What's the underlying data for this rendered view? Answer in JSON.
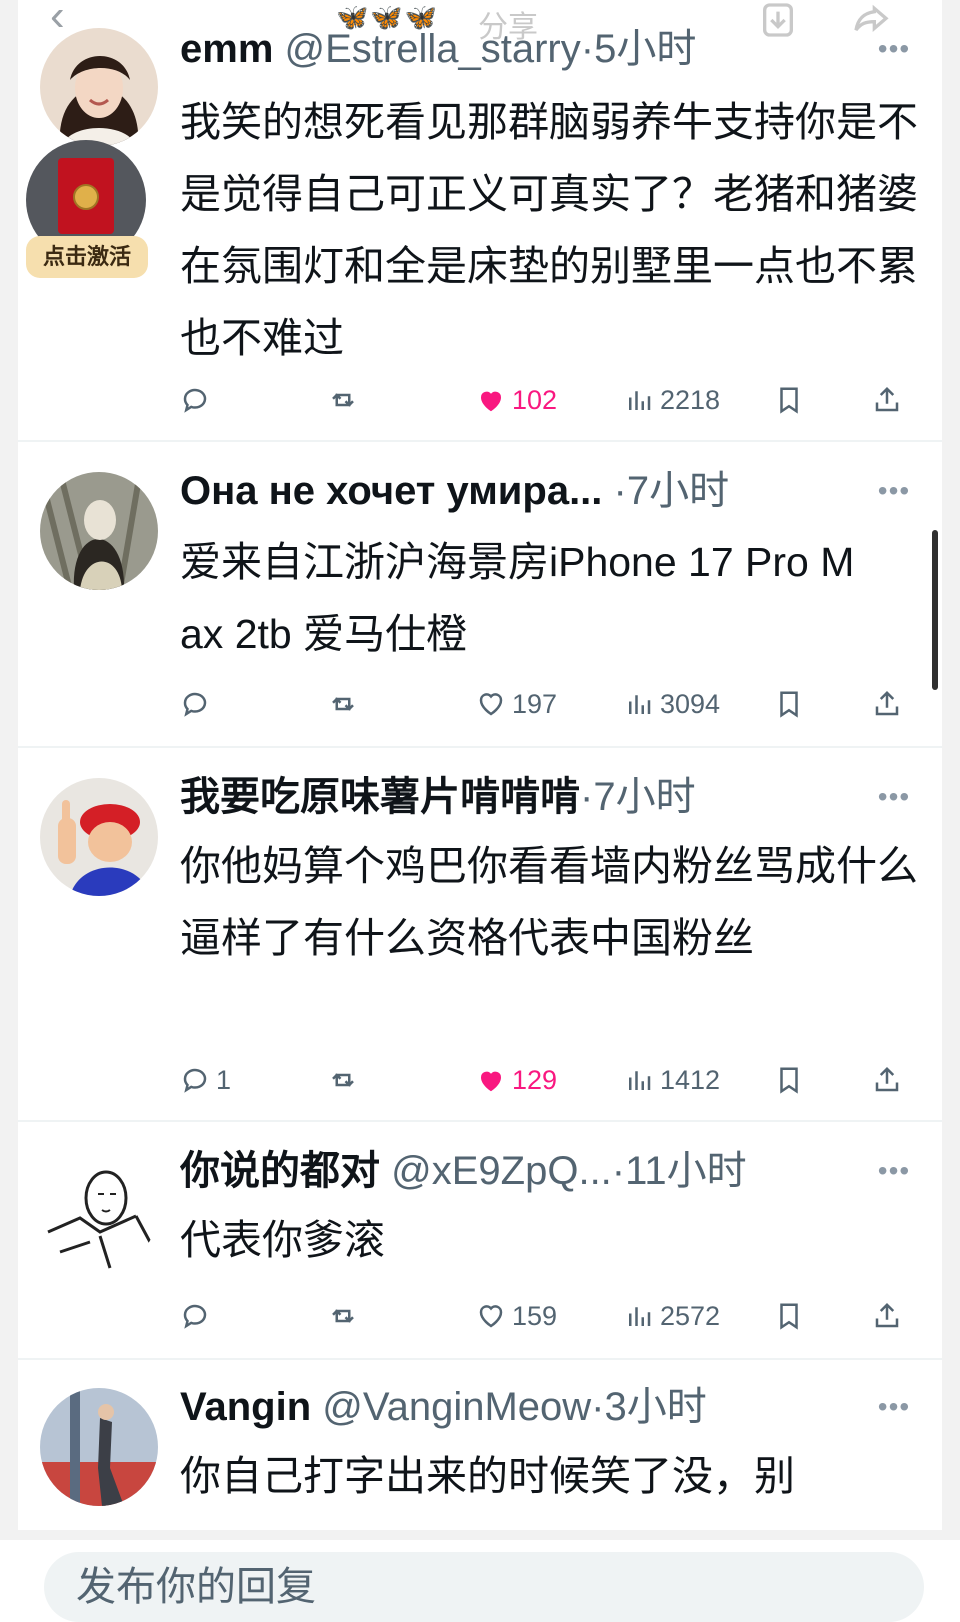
{
  "topbar": {
    "share_label": "分享",
    "decoration": "🦋🦋🦋"
  },
  "badge": {
    "label": "点击激活"
  },
  "tweets": [
    {
      "name": "emm",
      "handle": "@Estrella_starry",
      "time": "·5小时",
      "text": "我笑的想死看见那群脑弱养牛支持你是不是觉得自己可正义可真实了？老猪和猪婆在氛围灯和全是床垫的别墅里一点也不累 也不难过",
      "replies": "",
      "likes": "102",
      "liked": true,
      "views": "2218"
    },
    {
      "name": "Она не хочет умира...",
      "handle": "",
      "time": "·7小时",
      "text": "爱来自江浙沪海景房iPhone 17 Pro Max 2tb 爱马仕橙",
      "replies": "",
      "likes": "197",
      "liked": false,
      "views": "3094"
    },
    {
      "name": "我要吃原味薯片啃啃啃",
      "handle": "",
      "time": "·7小时",
      "text": "你他妈算个鸡巴你看看墙内粉丝骂成什么逼样了有什么资格代表中国粉丝",
      "replies": "1",
      "likes": "129",
      "liked": true,
      "views": "1412"
    },
    {
      "name": "你说的都对",
      "handle": "@xE9ZpQ...",
      "time": "·11小时",
      "text": "代表你爹滚",
      "replies": "",
      "likes": "159",
      "liked": false,
      "views": "2572"
    },
    {
      "name": "Vangin",
      "handle": "@VanginMeow",
      "time": "·3小时",
      "text": "你自己打字出来的时候笑了没，别"
    }
  ],
  "reply": {
    "placeholder": "发布你的回复"
  },
  "colors": {
    "like": "#f91880",
    "text": "#0f1419",
    "muted": "#536471"
  }
}
